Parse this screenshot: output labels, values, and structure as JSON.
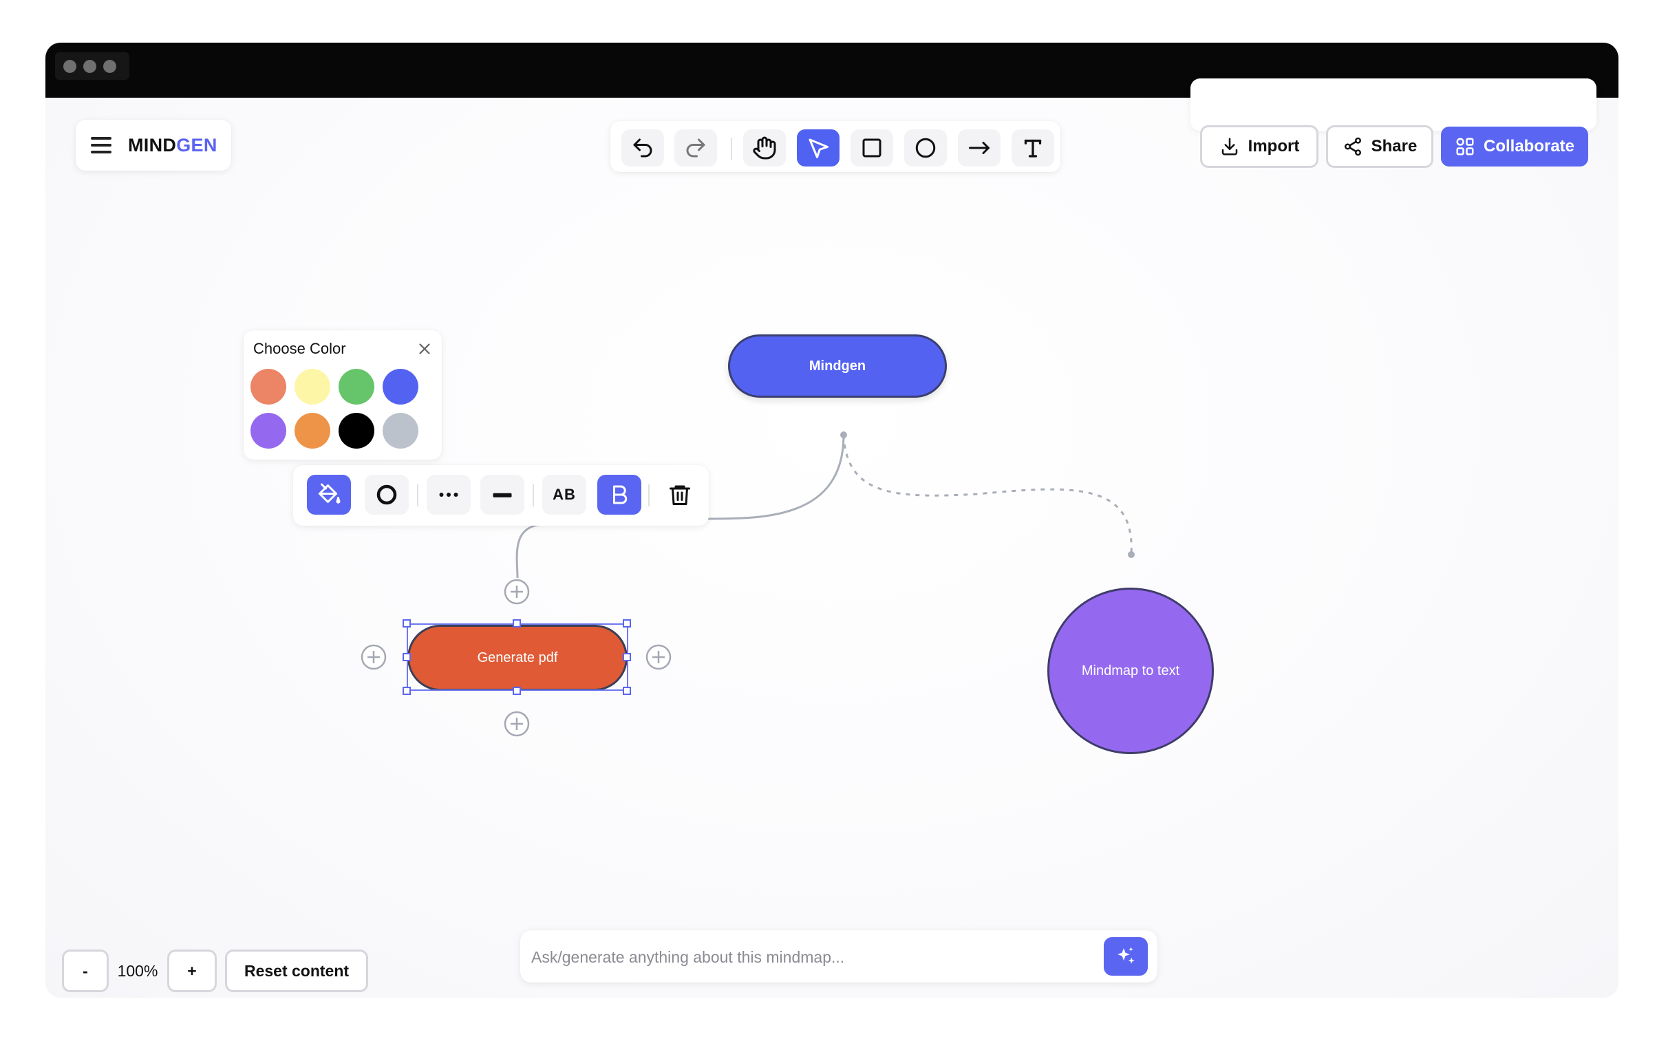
{
  "logo": {
    "part1": "MIND",
    "part2": "GEN"
  },
  "toolbar": {
    "tools": [
      "undo-icon",
      "redo-icon",
      "hand-icon",
      "select-cursor-icon",
      "rectangle-icon",
      "ellipse-icon",
      "arrow-icon",
      "text-icon"
    ],
    "active_tool": "select-cursor-icon"
  },
  "actions": {
    "import_label": "Import",
    "share_label": "Share",
    "collaborate_label": "Collaborate",
    "accent": "#5a66f1"
  },
  "color_picker": {
    "title": "Choose Color",
    "colors": [
      "#ec8466",
      "#fdf6a7",
      "#66c56a",
      "#5462f2",
      "#9469f0",
      "#ee9448",
      "#000000",
      "#bcc2cc"
    ]
  },
  "shape_toolbar": {
    "text_case_label": "AB",
    "tools": [
      "fill-bucket-icon",
      "stroke-circle-icon",
      "dots-icon",
      "line-thickness-icon",
      "text-case-icon",
      "bold-icon",
      "trash-icon"
    ]
  },
  "nodes": {
    "mindgen": {
      "label": "Mindgen",
      "color": "#5462f2"
    },
    "generate_pdf": {
      "label": "Generate pdf",
      "color": "#e05a36"
    },
    "mindmap_to_text": {
      "label": "Mindmap to text",
      "color": "#9469f0"
    }
  },
  "zoom": {
    "minus_label": "-",
    "value": "100%",
    "plus_label": "+",
    "reset_label": "Reset content"
  },
  "ask": {
    "placeholder": "Ask/generate anything about this mindmap..."
  }
}
